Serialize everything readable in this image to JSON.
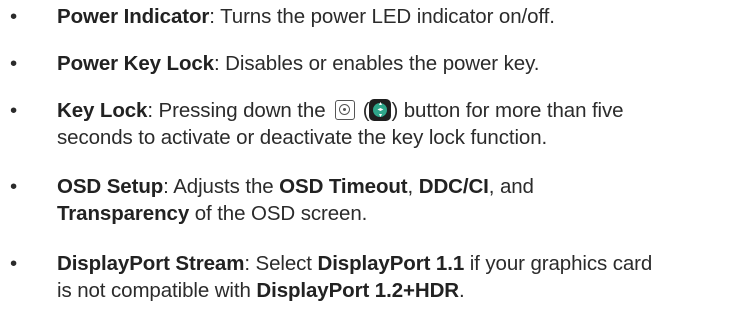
{
  "bullet": "•",
  "items": [
    {
      "term": "Power Indicator",
      "text": ": Turns the power LED indicator on/off."
    },
    {
      "term": "Power Key Lock",
      "text": ": Disables or enables the power key."
    },
    {
      "term": "Key Lock",
      "text_a": ": Pressing down the ",
      "icon_joystick": "joystick-button-icon",
      "paren_open": " (",
      "icon_nav": "navigation-key-icon",
      "text_b": ") button for more than five",
      "line2": "seconds to activate or deactivate the key lock function."
    },
    {
      "term": "OSD Setup",
      "text_a": ": Adjusts the ",
      "bold_a": "OSD Timeout",
      "sep": ", ",
      "bold_b": "DDC/CI",
      "text_b": ", and",
      "bold_c": "Transparency",
      "text_c": " of the OSD screen."
    },
    {
      "term": "DisplayPort Stream",
      "text_a": ": Select ",
      "bold_a": "DisplayPort 1.1",
      "text_b": " if your graphics card",
      "line2_a": "is not compatible with ",
      "bold_b": "DisplayPort 1.2+HDR",
      "line2_b": "."
    }
  ]
}
